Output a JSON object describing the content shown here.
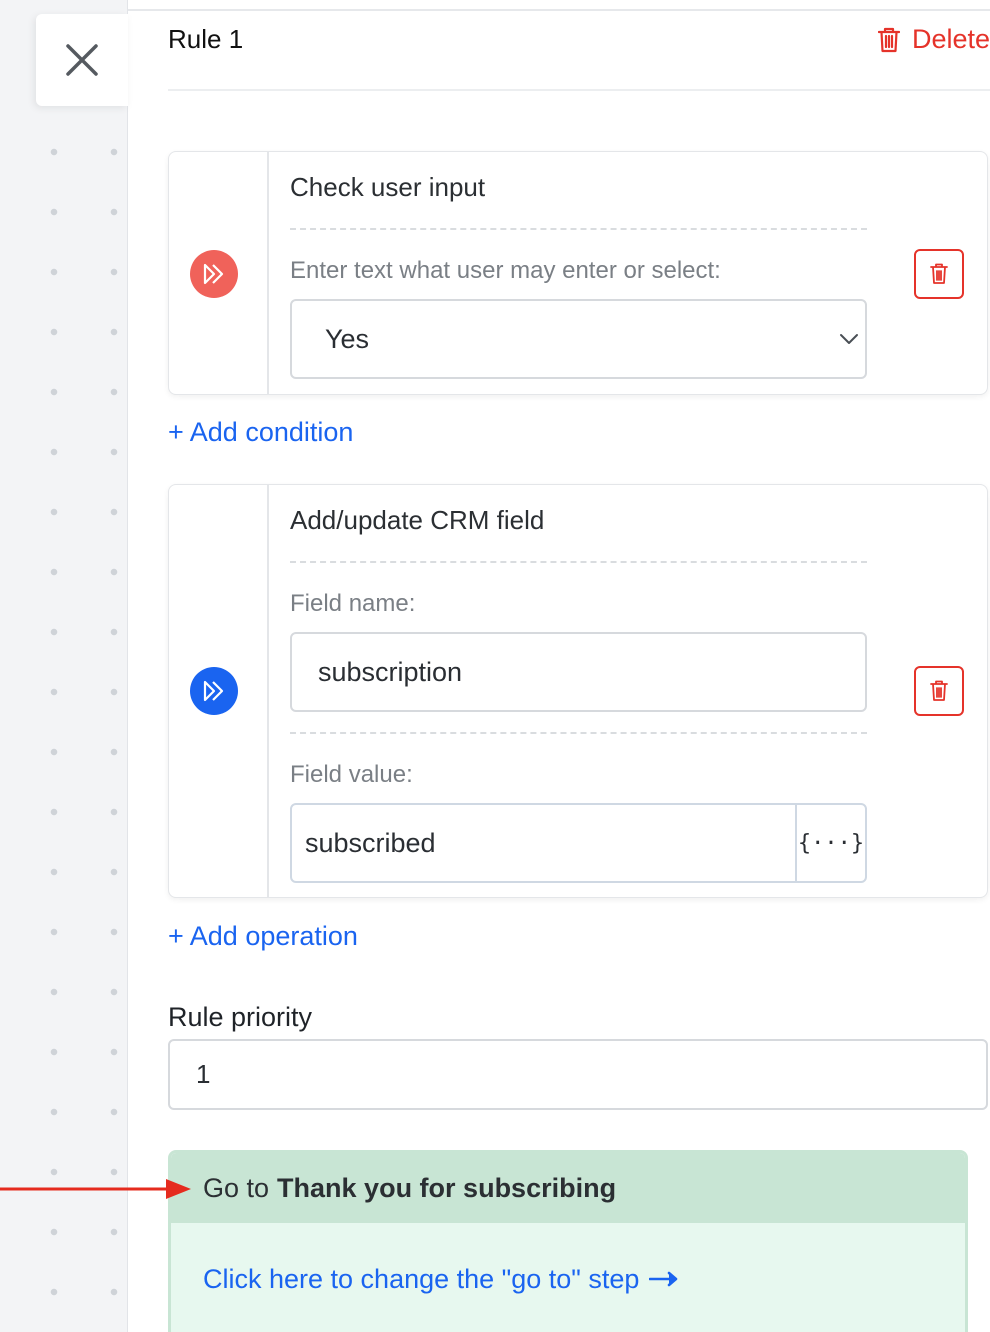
{
  "rule": {
    "title": "Rule 1",
    "delete_label": "Delete"
  },
  "condition_card": {
    "title": "Check user input",
    "label": "Enter text what user may enter or select:",
    "selected_value": "Yes",
    "icon_color": "#f0625a"
  },
  "add_condition_label": "+ Add condition",
  "operation_card": {
    "title": "Add/update CRM field",
    "field_name_label": "Field name:",
    "field_name_value": "subscription",
    "field_value_label": "Field value:",
    "field_value_value": "subscribed",
    "variable_button_label": "{···}",
    "icon_color": "#1a64f0"
  },
  "add_operation_label": "+ Add operation",
  "priority": {
    "label": "Rule priority",
    "value": "1"
  },
  "goto": {
    "prefix": "Go to",
    "step_name": "Thank you for subscribing",
    "change_link": "Click here to change the \"go to\" step"
  },
  "colors": {
    "accent": "#1a64f0",
    "danger": "#e5332a",
    "goto_header_bg": "#c8e5d4",
    "goto_body_bg": "#e7f8ef"
  }
}
